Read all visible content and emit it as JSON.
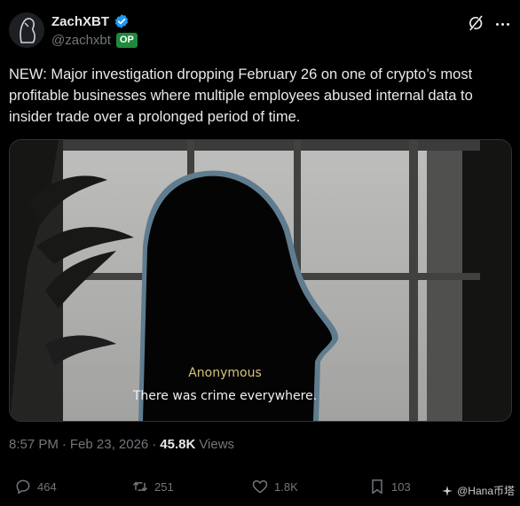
{
  "author": {
    "name": "ZachXBT",
    "handle": "@zachxbt",
    "badge": "OP"
  },
  "tweet": {
    "text": "NEW: Major investigation dropping February 26 on one of crypto’s most profitable businesses where multiple employees abused internal data to insider trade over a prolonged period of time."
  },
  "media": {
    "caption_name": "Anonymous",
    "caption_line": "There was crime everywhere."
  },
  "meta": {
    "time": "8:57 PM",
    "separator1": "·",
    "date": "Feb 23, 2026",
    "separator2": "·",
    "views_count": "45.8K",
    "views_label": "Views"
  },
  "actions": {
    "replies": "464",
    "reposts": "251",
    "likes": "1.8K",
    "bookmarks": "103"
  },
  "watermark": {
    "text": "@Hana币塔"
  },
  "colors": {
    "background": "#000000",
    "text": "#e7e9ea",
    "muted": "#71767b",
    "verified": "#1d9bf0",
    "op_badge": "#1f8a3b"
  }
}
